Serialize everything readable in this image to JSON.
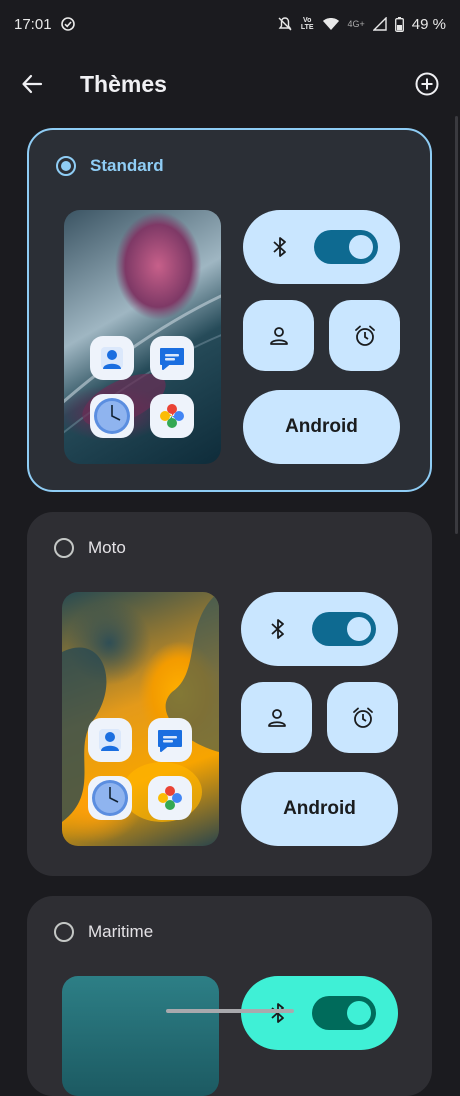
{
  "status_bar": {
    "time": "17:01",
    "network_top": "Vo",
    "network_bottom": "LTE",
    "mobile_type": "4G+",
    "battery": "49 %"
  },
  "header": {
    "title": "Thèmes"
  },
  "themes": [
    {
      "name": "Standard",
      "selected": true,
      "quick_label": "Android"
    },
    {
      "name": "Moto",
      "selected": false,
      "quick_label": "Android"
    },
    {
      "name": "Maritime",
      "selected": false
    }
  ],
  "icons": {
    "status": [
      "sync-check-icon",
      "notifications-off-icon",
      "volte-icon",
      "wifi-icon",
      "signal-icon",
      "battery-icon"
    ],
    "header": [
      "back-arrow-icon",
      "add-circle-icon"
    ],
    "quick_settings": [
      "bluetooth-icon",
      "person-icon",
      "alarm-icon"
    ],
    "apps": [
      "contacts-app-icon",
      "messages-app-icon",
      "clock-app-icon",
      "photos-app-icon"
    ]
  },
  "colors": {
    "background": "#1b1b1f",
    "card": "#2e2e33",
    "accent": "#8fcdf5",
    "tile": "#c9e6ff",
    "switch": "#0e6a91",
    "maritime_tile": "#3ff0d6"
  }
}
